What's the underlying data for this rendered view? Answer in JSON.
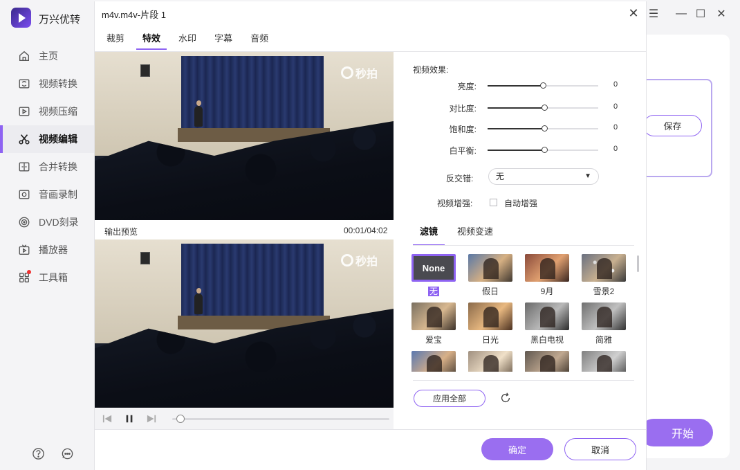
{
  "app": {
    "title": "万兴优转"
  },
  "sidebar": {
    "items": [
      {
        "label": "主页",
        "icon": "home-icon"
      },
      {
        "label": "视频转换",
        "icon": "convert-icon"
      },
      {
        "label": "视频压缩",
        "icon": "compress-icon"
      },
      {
        "label": "视频编辑",
        "icon": "scissors-icon",
        "active": true
      },
      {
        "label": "合并转换",
        "icon": "merge-icon"
      },
      {
        "label": "音画录制",
        "icon": "record-icon"
      },
      {
        "label": "DVD刻录",
        "icon": "dvd-icon"
      },
      {
        "label": "播放器",
        "icon": "player-icon"
      },
      {
        "label": "工具箱",
        "icon": "toolbox-icon",
        "badge": true
      }
    ],
    "bottom_icons": [
      "help-icon",
      "feedback-icon"
    ]
  },
  "background_window": {
    "save_label": "保存",
    "start_label": "开始"
  },
  "dialog": {
    "title": "m4v.m4v-片段 1",
    "tabs": [
      {
        "label": "裁剪"
      },
      {
        "label": "特效",
        "active": true
      },
      {
        "label": "水印"
      },
      {
        "label": "字幕"
      },
      {
        "label": "音频"
      }
    ],
    "video": {
      "watermark": "秒拍",
      "preview_label": "输出预览",
      "time": "00:01/04:02",
      "progress": 0.02
    },
    "effects": {
      "section_title": "视频效果:",
      "sliders": [
        {
          "label": "亮度:",
          "value": "0",
          "position": 0.5
        },
        {
          "label": "对比度:",
          "value": "0",
          "position": 0.51
        },
        {
          "label": "饱和度:",
          "value": "0",
          "position": 0.51
        },
        {
          "label": "白平衡:",
          "value": "0",
          "position": 0.51
        }
      ],
      "deinterlace_label": "反交错:",
      "deinterlace_value": "无",
      "enhance_label": "视频增强:",
      "auto_enhance_label": "自动增强",
      "auto_enhance_checked": false
    },
    "filter_tabs": [
      {
        "label": "滤镜",
        "active": true
      },
      {
        "label": "视频变速"
      }
    ],
    "filters": [
      {
        "label": "无",
        "thumb_text": "None",
        "selected": true
      },
      {
        "label": "假日"
      },
      {
        "label": "9月"
      },
      {
        "label": "雪景2"
      },
      {
        "label": "爱宝"
      },
      {
        "label": "日光"
      },
      {
        "label": "黑白电视"
      },
      {
        "label": "简雅"
      },
      {
        "label": ""
      },
      {
        "label": ""
      },
      {
        "label": ""
      },
      {
        "label": ""
      }
    ],
    "apply_all_label": "应用全部",
    "ok_label": "确定",
    "cancel_label": "取消"
  }
}
